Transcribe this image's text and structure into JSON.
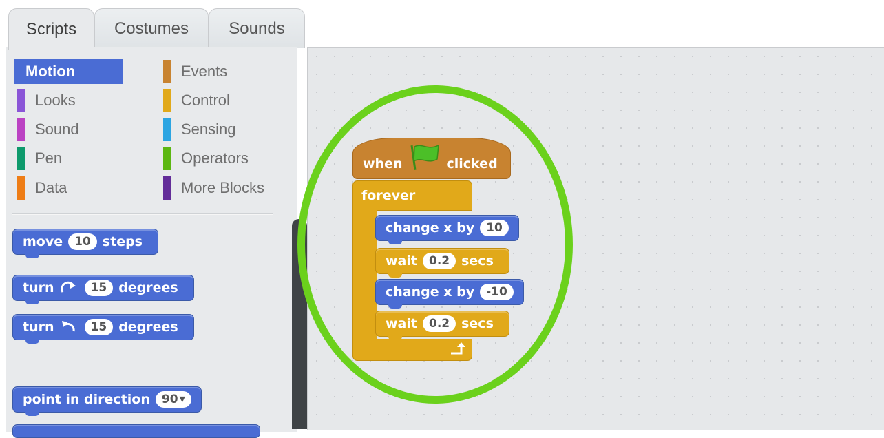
{
  "tabs": [
    {
      "label": "Scripts",
      "active": true
    },
    {
      "label": "Costumes",
      "active": false
    },
    {
      "label": "Sounds",
      "active": false
    }
  ],
  "categories": [
    {
      "label": "Motion",
      "color": "#4a6cd4",
      "selected": true
    },
    {
      "label": "Looks",
      "color": "#8a55d7",
      "selected": false
    },
    {
      "label": "Sound",
      "color": "#bb42c3",
      "selected": false
    },
    {
      "label": "Pen",
      "color": "#0e9a6c",
      "selected": false
    },
    {
      "label": "Data",
      "color": "#ee7d16",
      "selected": false
    },
    {
      "label": "Events",
      "color": "#c88330",
      "selected": false
    },
    {
      "label": "Control",
      "color": "#e1a91a",
      "selected": false
    },
    {
      "label": "Sensing",
      "color": "#2ca5e2",
      "selected": false
    },
    {
      "label": "Operators",
      "color": "#5cb712",
      "selected": false
    },
    {
      "label": "More Blocks",
      "color": "#632d99",
      "selected": false
    }
  ],
  "palette": {
    "move": {
      "word1": "move",
      "value": "10",
      "word2": "steps"
    },
    "turn_right": {
      "word1": "turn",
      "icon": "rotate-clockwise-icon",
      "value": "15",
      "word2": "degrees"
    },
    "turn_left": {
      "word1": "turn",
      "icon": "rotate-counterclockwise-icon",
      "value": "15",
      "word2": "degrees"
    },
    "point": {
      "word1": "point in direction",
      "value": "90"
    }
  },
  "script": {
    "hat": {
      "word1": "when",
      "icon": "green-flag-icon",
      "word2": "clicked"
    },
    "forever": "forever",
    "blocks": [
      {
        "text": "change x by",
        "value": "10"
      },
      {
        "text": "wait",
        "value": "0.2",
        "suffix": "secs"
      },
      {
        "text": "change x by",
        "value": "-10"
      },
      {
        "text": "wait",
        "value": "0.2",
        "suffix": "secs"
      }
    ],
    "loop_icon": "loop-arrow-icon"
  },
  "colors": {
    "motion": "#4a6cd4",
    "control": "#e1a91a",
    "events": "#c88330",
    "highlight": "#6bd11c"
  }
}
